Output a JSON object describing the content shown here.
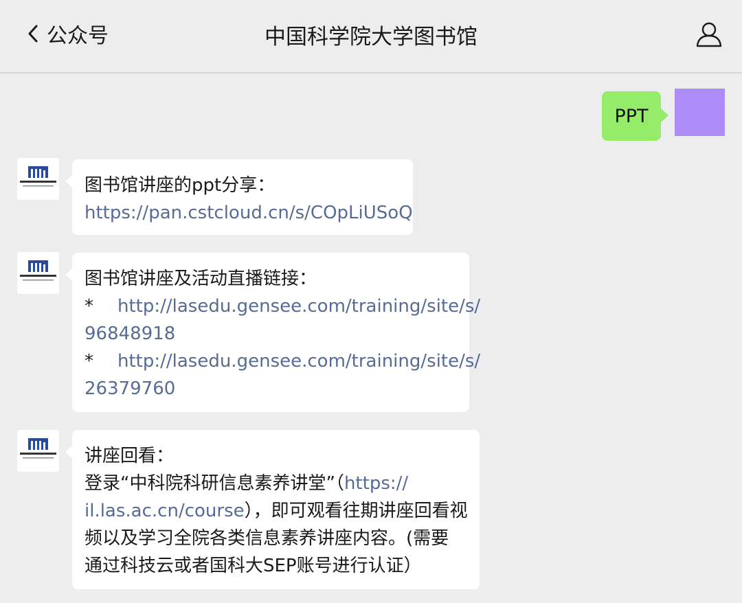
{
  "header": {
    "back_label": "公众号",
    "title": "中国科学院大学图书馆"
  },
  "colors": {
    "outgoing_bubble": "#95ec69",
    "incoming_bubble": "#ffffff",
    "link": "#566c95",
    "background": "#ededed",
    "self_avatar": "#ad8cf7"
  },
  "icons": {
    "back": "chevron-left-icon",
    "profile": "person-outline-icon",
    "avatar": "library-logo-icon"
  },
  "messages": [
    {
      "direction": "outgoing",
      "text": "PPT"
    },
    {
      "direction": "incoming",
      "line1": "图书馆讲座的ppt分享：",
      "link1": "https://pan.cstcloud.cn/s/COpLiUSoQ"
    },
    {
      "direction": "incoming",
      "line1": "图书馆讲座及活动直播链接：",
      "bullet": "*",
      "link1_part1": "http://lasedu.gensee.com/training/site/s/",
      "link1_part2": "96848918",
      "link2_part1": "http://lasedu.gensee.com/training/site/s/",
      "link2_part2": "26379760"
    },
    {
      "direction": "incoming",
      "line1": "讲座回看：",
      "line2_text": "登录“中科院科研信息素养讲堂”（",
      "line2_link": "https://",
      "line3_link": "il.las.ac.cn/course",
      "line3_text": "），即可观看往期讲座回看视",
      "line4": "频以及学习全院各类信息素养讲座内容。(需要",
      "line5": "通过科技云或者国科大SEP账号进行认证）"
    }
  ]
}
